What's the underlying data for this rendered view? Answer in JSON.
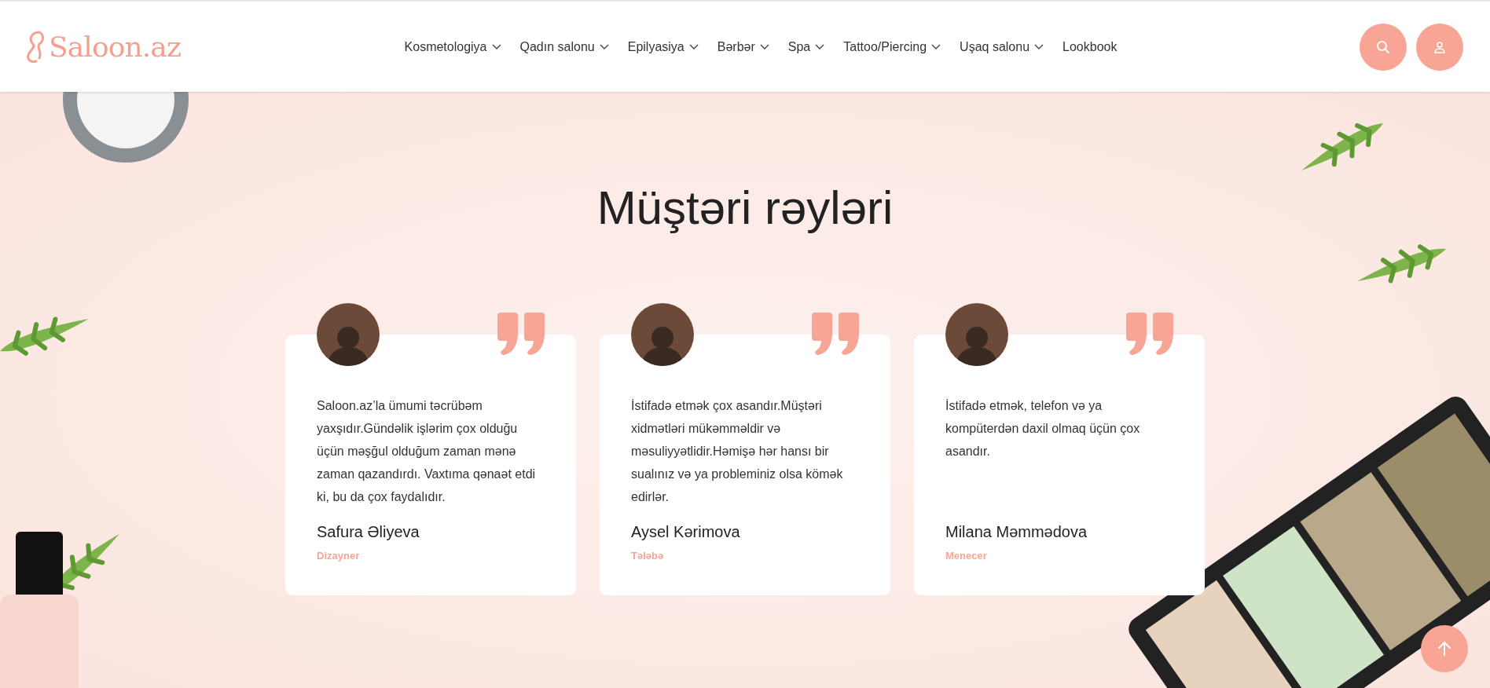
{
  "header": {
    "logo": "Saloon.az",
    "nav": [
      {
        "label": "Kosmetologiya",
        "dropdown": true
      },
      {
        "label": "Qadın salonu",
        "dropdown": true
      },
      {
        "label": "Epilyasiya",
        "dropdown": true
      },
      {
        "label": "Bərbər",
        "dropdown": true
      },
      {
        "label": "Spa",
        "dropdown": true
      },
      {
        "label": "Tattoo/Piercing",
        "dropdown": true
      },
      {
        "label": "Uşaq salonu",
        "dropdown": true
      },
      {
        "label": "Lookbook",
        "dropdown": false
      }
    ]
  },
  "section": {
    "title": "Müştəri rəyləri",
    "testimonials": [
      {
        "text": "Saloon.az’la ümumi təcrübəm yaxşıdır.Gündəlik işlərim çox olduğu üçün məşğul olduğum zaman mənə zaman qazandırdı. Vaxtıma qənaət etdi ki, bu da çox faydalıdır.",
        "name": "Safura Əliyeva",
        "role": "Dizayner"
      },
      {
        "text": "İstifadə etmək çox asandır.Müştəri xidmətləri mükəmməldir və məsuliyyətlidir.Həmişə hər hansı bir sualınız və ya probleminiz olsa kömək edirlər.",
        "name": "Aysel Kərimova",
        "role": "Tələbə"
      },
      {
        "text": "İstifadə etmək, telefon və ya kompüterdən daxil olmaq üçün çox asandır.",
        "name": "Milana Məmmədova",
        "role": "Menecer"
      }
    ]
  }
}
